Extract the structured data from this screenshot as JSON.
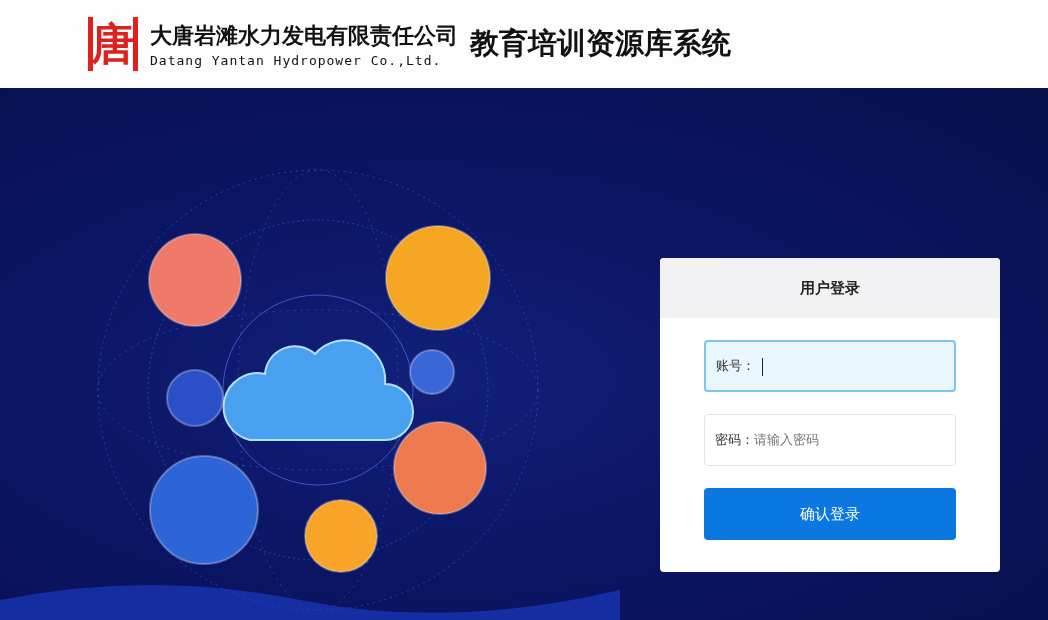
{
  "header": {
    "logo_glyph": "唐",
    "company_name": "大唐岩滩水力发电有限责任公司",
    "company_name_en": "Datang Yantan Hydropower Co.,Ltd.",
    "system_title": "教育培训资源库系统"
  },
  "login": {
    "title": "用户登录",
    "fields": [
      {
        "label": "账号：",
        "focused": true
      },
      {
        "label": "密码：",
        "placeholder": "请输入密码",
        "focused": false
      }
    ],
    "submit": "确认登录"
  }
}
